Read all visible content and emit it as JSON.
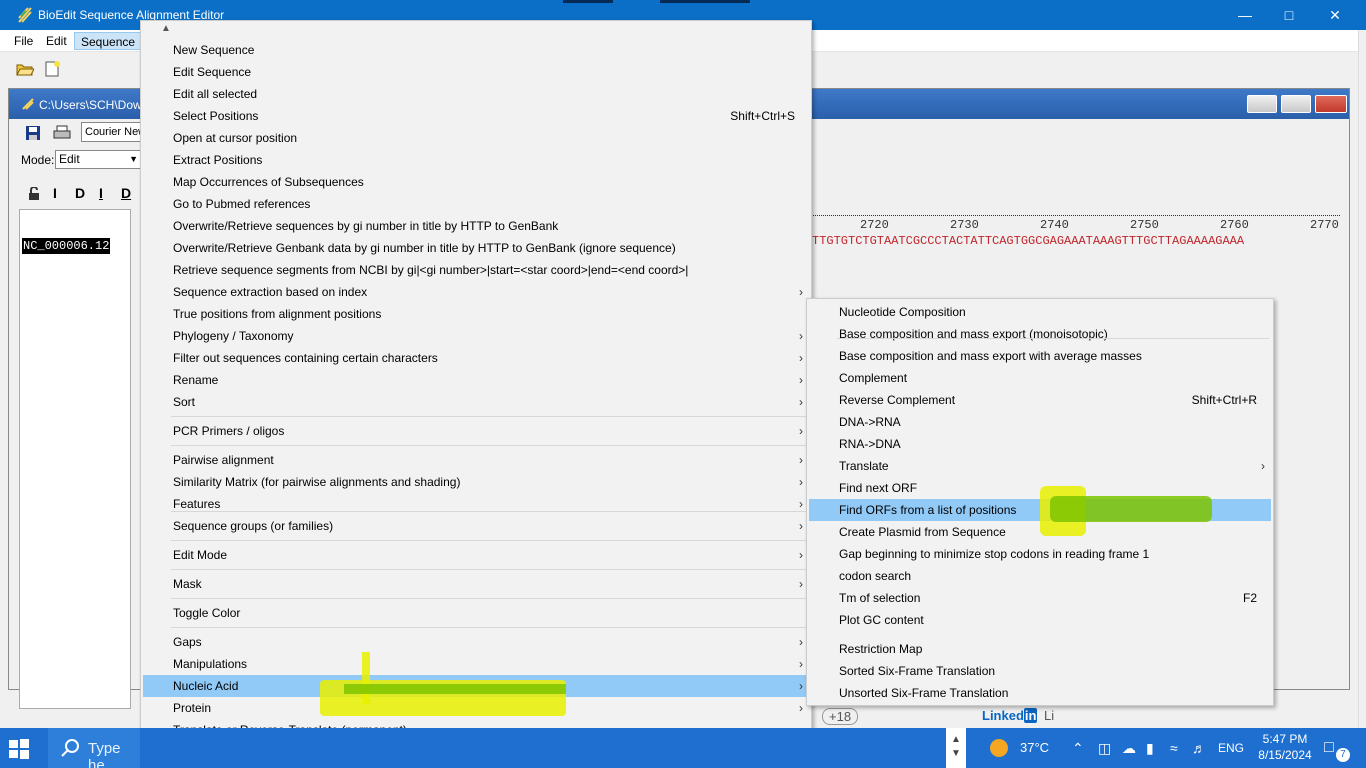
{
  "window": {
    "title": "BioEdit Sequence Alignment Editor"
  },
  "menubar": {
    "items": [
      "File",
      "Edit",
      "Sequence"
    ]
  },
  "mdi": {
    "title": "C:\\Users\\SCH\\Dow",
    "font_select": "Courier New",
    "mode_label": "Mode:",
    "mode_value": "Edit",
    "sequence_name": "NC_000006.12",
    "ruler": [
      "2720",
      "2730",
      "2740",
      "2750",
      "2760",
      "2770"
    ],
    "sequence": "TTGTGTCTGTAATCGCCCTACTATTCAGTGGCGAGAAATAAAGTTTGCTTAGAAAAGAAA",
    "toolbar_letters": [
      "I",
      "D",
      "I",
      "D"
    ]
  },
  "sequence_menu": [
    {
      "label": "New Sequence"
    },
    {
      "label": "Edit Sequence"
    },
    {
      "label": "Edit all selected"
    },
    {
      "label": "Select Positions",
      "shortcut": "Shift+Ctrl+S"
    },
    {
      "label": "Open at cursor position"
    },
    {
      "label": "Extract Positions"
    },
    {
      "label": "Map Occurrences of Subsequences"
    },
    {
      "label": "Go to Pubmed references"
    },
    {
      "label": "Overwrite/Retrieve sequences by gi number in title by HTTP to GenBank"
    },
    {
      "label": "Overwrite/Retrieve Genbank data by gi number in title by HTTP to GenBank (ignore sequence)"
    },
    {
      "label": "Retrieve sequence segments from NCBI by gi|<gi number>|start=<star coord>|end=<end coord>|"
    },
    {
      "label": "Sequence extraction based on index",
      "submenu": true
    },
    {
      "label": "True positions from alignment positions"
    },
    {
      "label": "Phylogeny / Taxonomy",
      "submenu": true
    },
    {
      "label": "Filter out sequences containing certain characters",
      "submenu": true
    },
    {
      "label": "Rename",
      "submenu": true
    },
    {
      "label": "Sort",
      "submenu": true
    },
    {
      "label": "PCR Primers / oligos",
      "submenu": true
    },
    {
      "label": "Pairwise alignment",
      "submenu": true
    },
    {
      "label": "Similarity Matrix (for pairwise alignments and shading)",
      "submenu": true
    },
    {
      "label": "Features",
      "submenu": true
    },
    {
      "label": "Sequence groups (or families)",
      "submenu": true
    },
    {
      "label": "Edit Mode",
      "submenu": true
    },
    {
      "label": "Mask",
      "submenu": true
    },
    {
      "label": "Toggle Color"
    },
    {
      "label": "Gaps",
      "submenu": true
    },
    {
      "label": "Manipulations",
      "submenu": true
    },
    {
      "label": "Nucleic Acid",
      "submenu": true
    },
    {
      "label": "Protein",
      "submenu": true
    },
    {
      "label": "Translate or Reverse-Translate (permanent)"
    }
  ],
  "nucleic_menu": [
    {
      "label": "Nucleotide Composition"
    },
    {
      "label": "Base composition and mass export (monoisotopic)"
    },
    {
      "label": "Base composition and mass export with average masses"
    },
    {
      "label": "Complement"
    },
    {
      "label": "Reverse Complement",
      "shortcut": "Shift+Ctrl+R"
    },
    {
      "label": "DNA->RNA"
    },
    {
      "label": "RNA->DNA"
    },
    {
      "label": "Translate",
      "submenu": true
    },
    {
      "label": "Find next ORF"
    },
    {
      "label": "Find ORFs from a list of positions"
    },
    {
      "label": "Create Plasmid from Sequence"
    },
    {
      "label": "Gap beginning to minimize stop codons in reading frame 1"
    },
    {
      "label": "codon search"
    },
    {
      "label": "Tm of selection",
      "shortcut": "F2"
    },
    {
      "label": "Plot GC content"
    },
    {
      "label": "Restriction Map"
    },
    {
      "label": "Sorted Six-Frame Translation"
    },
    {
      "label": "Unsorted Six-Frame Translation"
    }
  ],
  "background_text": {
    "plus_badge": "+18",
    "linkedin": "Linked",
    "linkedin_in": "in",
    "linkedin_tail": "Li"
  },
  "taskbar": {
    "search_placeholder": "Type he",
    "temperature": "37°C",
    "language": "ENG",
    "time": "5:47 PM",
    "date": "8/15/2024",
    "notification_count": "7"
  },
  "colors": {
    "title_blue": "#0b6fc7",
    "menu_selection": "#91c9f7",
    "highlight_yellow": "#e8f000",
    "highlight_green": "#7cc400"
  }
}
